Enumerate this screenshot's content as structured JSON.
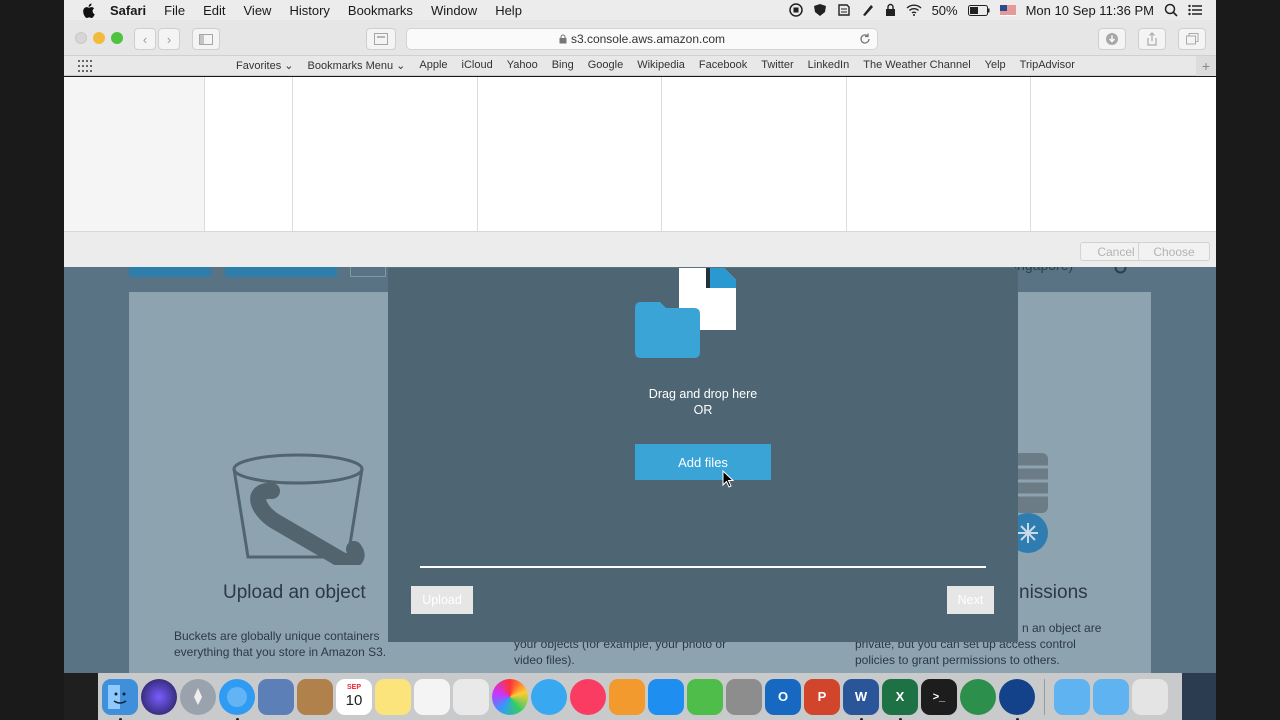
{
  "menubar": {
    "app_name": "Safari",
    "items": [
      "File",
      "Edit",
      "View",
      "History",
      "Bookmarks",
      "Window",
      "Help"
    ],
    "battery": "50%",
    "clock": "Mon 10 Sep  11:36 PM"
  },
  "browser": {
    "url": "s3.console.aws.amazon.com",
    "favorites": [
      "Favorites ⌄",
      "Bookmarks Menu ⌄",
      "Apple",
      "iCloud",
      "Yahoo",
      "Bing",
      "Google",
      "Wikipedia",
      "Facebook",
      "Twitter",
      "LinkedIn",
      "The Weather Channel",
      "Yelp",
      "TripAdvisor"
    ]
  },
  "file_picker": {
    "cancel_label": "Cancel",
    "choose_label": "Choose"
  },
  "aws_page": {
    "region_fragment": "ingapore)",
    "card1_title": "Upload an object",
    "card1_text_l1": "Buckets are globally unique containers",
    "card1_text_l2": "everything that you store in Amazon S3.",
    "card2_text_l1": "your objects (for example, your photo or",
    "card2_text_l2": "video files).",
    "card3_title_fragment": "nissions",
    "card3_text_l1": "n an object are",
    "card3_text_l2": "private, but you can set up access control",
    "card3_text_l3": "policies to grant permissions to others."
  },
  "upload_modal": {
    "drag_text": "Drag and drop here",
    "or_text": "OR",
    "add_files_label": "Add files",
    "upload_label": "Upload",
    "next_label": "Next"
  },
  "dock": {
    "calendar_month": "SEP",
    "calendar_day": "10"
  }
}
